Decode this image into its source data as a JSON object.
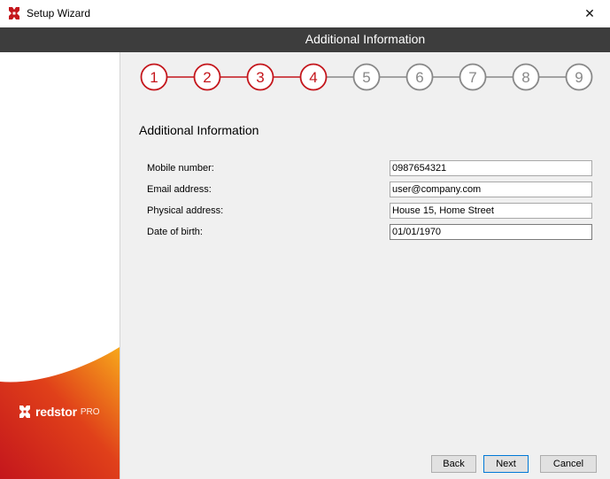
{
  "window": {
    "title": "Setup Wizard",
    "close_glyph": "✕"
  },
  "header": {
    "title": "Additional Information"
  },
  "brand": {
    "name": "redstor",
    "suffix": "PRO"
  },
  "steps": {
    "labels": [
      "1",
      "2",
      "3",
      "4",
      "5",
      "6",
      "7",
      "8",
      "9"
    ],
    "current": 4,
    "active_color": "#c4161c",
    "inactive_color": "#888888"
  },
  "main": {
    "section_title": "Additional Information"
  },
  "form": {
    "mobile": {
      "label": "Mobile number:",
      "value": "0987654321"
    },
    "email": {
      "label": "Email address:",
      "value": "user@company.com"
    },
    "address": {
      "label": "Physical address:",
      "value": "House 15, Home Street"
    },
    "dob": {
      "label": "Date of birth:",
      "value": "01/01/1970"
    }
  },
  "buttons": {
    "back": "Back",
    "next": "Next",
    "cancel": "Cancel"
  },
  "colors": {
    "header_bg": "#3d3d3d",
    "accent": "#c4161c",
    "brand_gradient": [
      "#c4161c",
      "#f7a81b"
    ]
  }
}
